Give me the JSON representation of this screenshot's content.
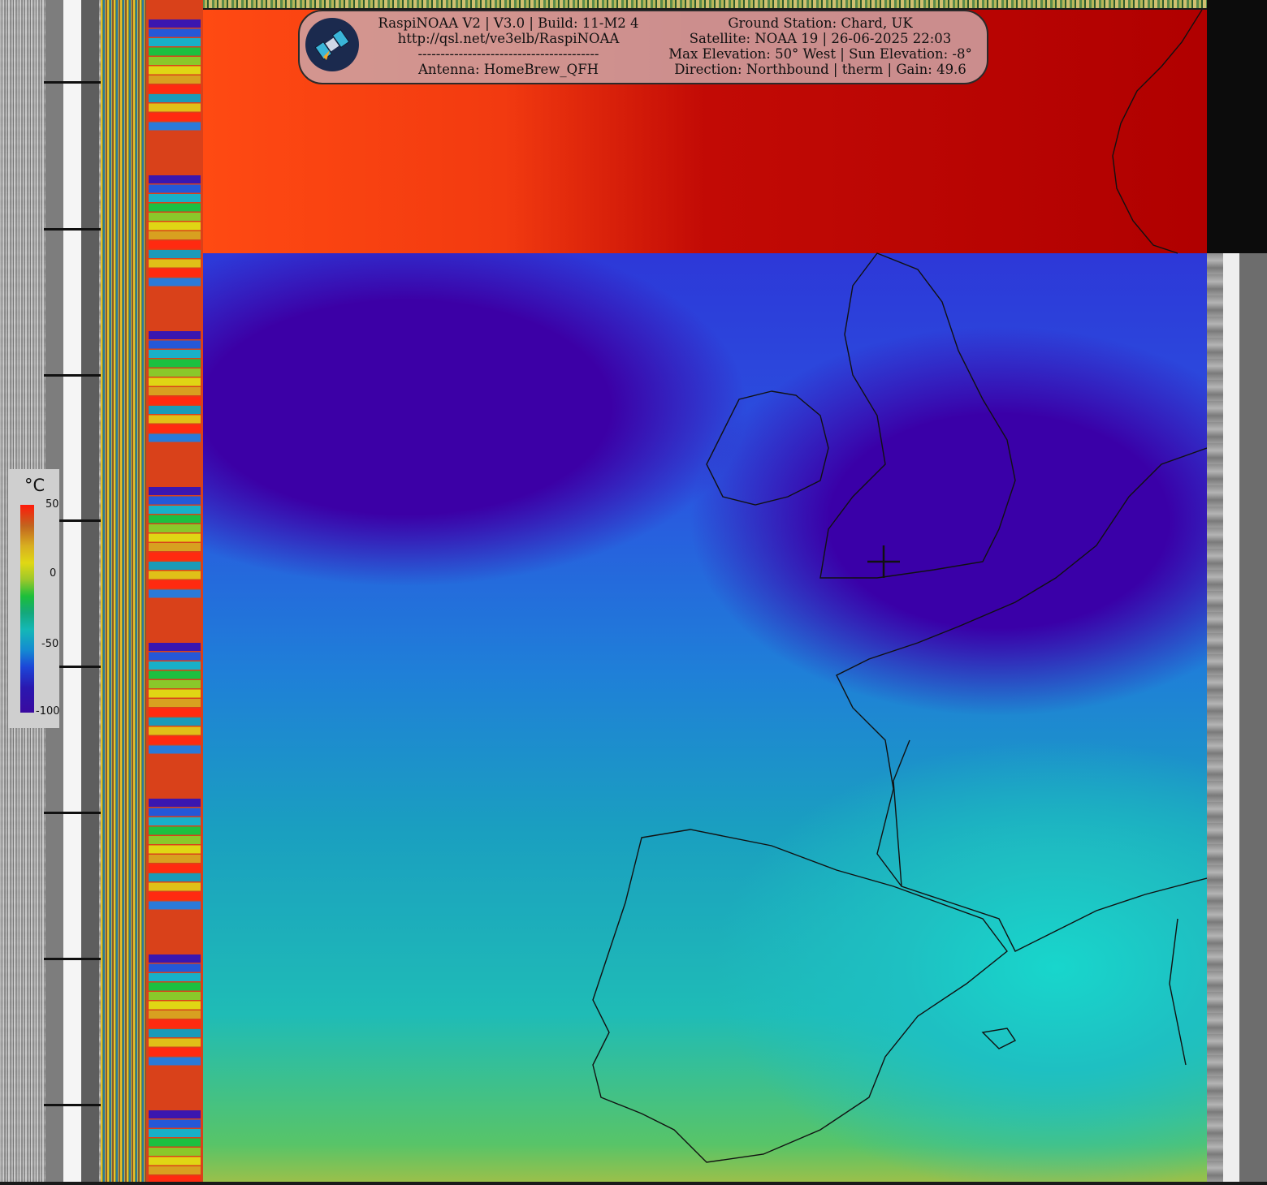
{
  "header": {
    "left_lines": [
      "RaspiNOAA V2 | V3.0 | Build: 11-M2 4",
      "http://qsl.net/ve3elb/RaspiNOAA",
      "----------------------------------------",
      "Antenna: HomeBrew_QFH"
    ],
    "right_lines": [
      "Ground Station: Chard, UK",
      "Satellite: NOAA 19 | 26-06-2025 22:03",
      "Max Elevation: 50° West | Sun Elevation: -8°",
      "Direction: Northbound | therm | Gain: 49.6"
    ]
  },
  "legend": {
    "unit": "°C",
    "labels": [
      "50",
      "0",
      "-50",
      "-100"
    ]
  },
  "colors": {
    "warm_space": "#b00000",
    "cold_cloud": "#3c00a6",
    "sea": "#1fbcb6",
    "header_bg": "#cda0a0"
  },
  "icons": {
    "logo": "satellite-icon",
    "marker": "crosshair-icon"
  }
}
